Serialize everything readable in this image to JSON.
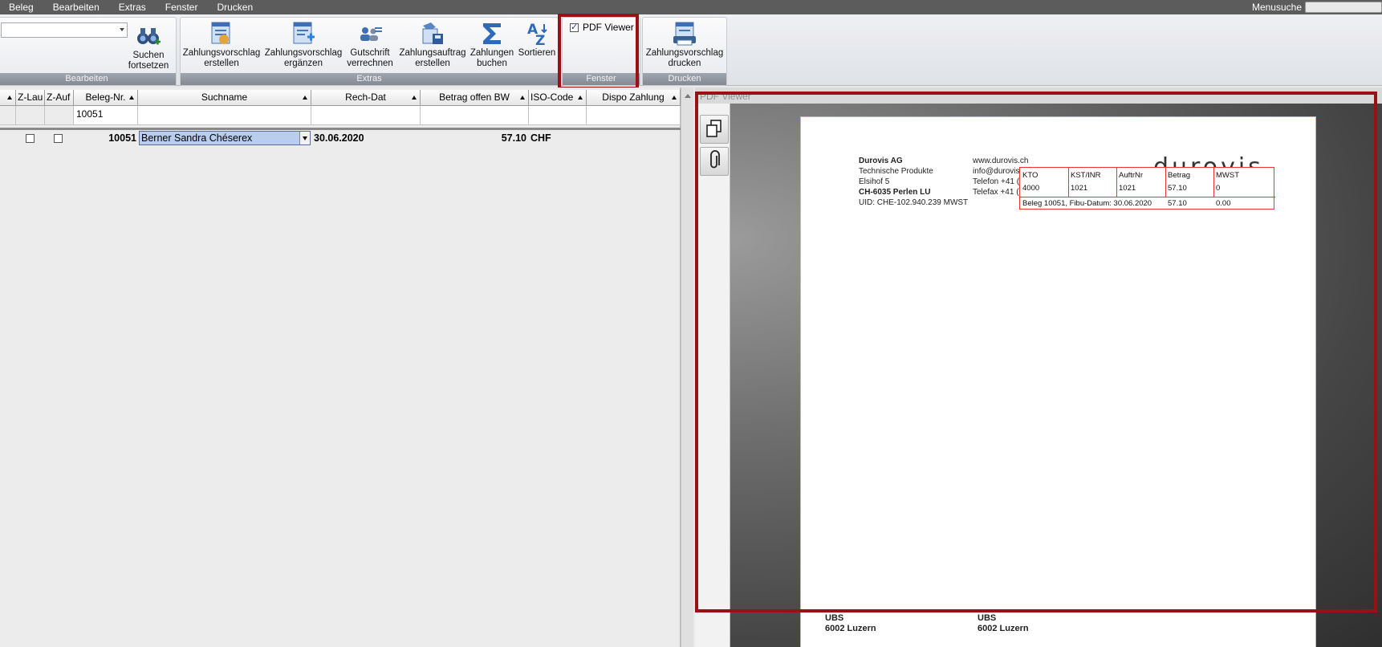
{
  "menu": {
    "items": [
      "Beleg",
      "Bearbeiten",
      "Extras",
      "Fenster",
      "Drucken"
    ],
    "search_label": "Menusuche"
  },
  "ribbon": {
    "bearbeiten": {
      "search_next": "Suchen\nfortsetzen",
      "footer": "Bearbeiten"
    },
    "extras": {
      "btn_vorschlag_erstellen": "Zahlungsvorschlag\nerstellen",
      "btn_vorschlag_ergaenzen": "Zahlungsvorschlag\nergänzen",
      "btn_gutschrift": "Gutschrift\nverrechnen",
      "btn_auftrag": "Zahlungsauftrag\nerstellen",
      "btn_buchen": "Zahlungen\nbuchen",
      "btn_sortieren": "Sortieren",
      "footer": "Extras"
    },
    "fenster": {
      "pdf_viewer_label": "PDF Viewer",
      "pdf_viewer_checked": true,
      "footer": "Fenster"
    },
    "drucken": {
      "btn_drucken": "Zahlungsvorschlag\ndrucken",
      "footer": "Drucken"
    }
  },
  "grid": {
    "columns": [
      "Z-Lau",
      "Z-Auf",
      "Beleg-Nr.",
      "Suchname",
      "Rech-Dat",
      "Betrag offen BW",
      "ISO-Code",
      "Dispo Zahlung"
    ],
    "filter": {
      "beleg_nr": "10051"
    },
    "rows": [
      {
        "beleg_nr": "10051",
        "suchname": "Berner Sandra Chéserex",
        "rech_dat": "30.06.2020",
        "betrag": "57.10",
        "iso": "CHF"
      }
    ]
  },
  "pdf": {
    "title": "PDF Viewer",
    "sender": {
      "company": "Durovis AG",
      "line1": "Technische Produkte",
      "line2": "Elsihof 5",
      "city": "CH-6035 Perlen LU",
      "uid": "UID: CHE-102.940.239 MWST"
    },
    "contact": {
      "web": "www.durovis.ch",
      "mail": "info@durovis.",
      "tel": "Telefon +41 (0",
      "fax": "Telefax +41 (0"
    },
    "logo_text": "durovis",
    "stamp": {
      "headers": [
        "KTO",
        "KST/INR",
        "AuftrNr",
        "Betrag",
        "MWST"
      ],
      "values": [
        "4000",
        "1021",
        "1021",
        "57.10",
        "0"
      ],
      "beleg_line": "Beleg 10051, Fibu-Datum: 30.06.2020",
      "beleg_betrag": "57.10",
      "beleg_mwst": "0.00"
    },
    "footer": {
      "left_bank": "UBS",
      "left_city": "6002 Luzern",
      "right_bank": "UBS",
      "right_city": "6002 Luzern"
    }
  }
}
